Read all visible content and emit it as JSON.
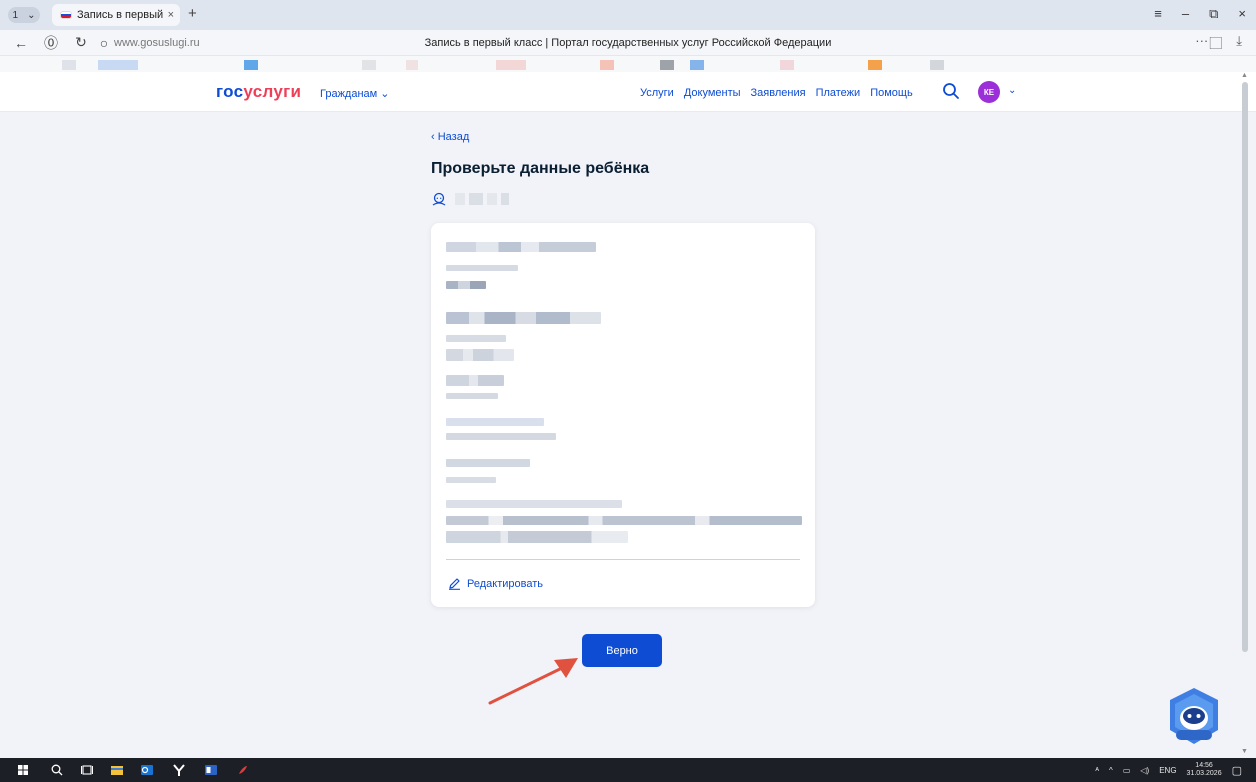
{
  "browser": {
    "tab_counter": "1",
    "tab_counter_chevron": "⌄",
    "tab_title": "Запись в первый класс",
    "tab_close": "×",
    "new_tab": "+",
    "window_controls": [
      "≡",
      "–",
      "⧉",
      "×"
    ],
    "url": "www.gosuslugi.ru",
    "page_title": "Запись в первый класс | Портал государственных услуг Российской Федерации",
    "addr_right": [
      "···",
      "⃞",
      "⤓"
    ]
  },
  "header": {
    "logo_part1": "гос",
    "logo_part2": "услуги",
    "citizens": "Гражданам",
    "citizens_chevron": "⌄",
    "nav": [
      "Услуги",
      "Документы",
      "Заявления",
      "Платежи",
      "Помощь"
    ],
    "avatar_initials": "КЕ",
    "avatar_chevron": "⌄"
  },
  "content": {
    "back_label": "‹ Назад",
    "title": "Проверьте данные ребёнка",
    "edit_label": "Редактировать",
    "confirm_label": "Верно"
  },
  "scrollbar": {
    "up": "▲",
    "down": "▼"
  },
  "taskbar": {
    "lang": "ENG",
    "time": "14:56",
    "date": "31.03.2026"
  },
  "colors": {
    "primary": "#0d4cd3",
    "logo_accent": "#ee3f58",
    "avatar": "#9b2fd8",
    "annotation_arrow": "#e0523f",
    "page_bg": "#f1f3f8"
  }
}
